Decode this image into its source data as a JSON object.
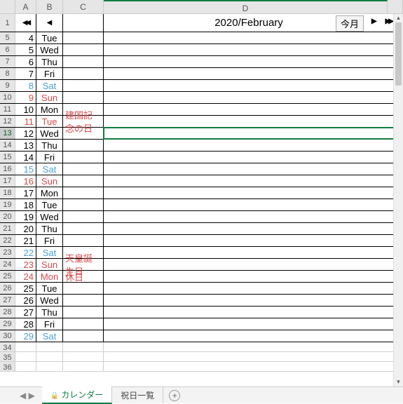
{
  "title": "2020/February",
  "today_btn": "今月",
  "nav": {
    "prev2": "◀◀",
    "prev": "◀",
    "next": "▶",
    "next2": "▶▶"
  },
  "columns": [
    "A",
    "B",
    "C",
    "D"
  ],
  "selected_row": 13,
  "rows": [
    {
      "n": 5,
      "day": "4",
      "dow": "Tue",
      "note": "",
      "cls": ""
    },
    {
      "n": 6,
      "day": "5",
      "dow": "Wed",
      "note": "",
      "cls": ""
    },
    {
      "n": 7,
      "day": "6",
      "dow": "Thu",
      "note": "",
      "cls": ""
    },
    {
      "n": 8,
      "day": "7",
      "dow": "Fri",
      "note": "",
      "cls": ""
    },
    {
      "n": 9,
      "day": "8",
      "dow": "Sat",
      "note": "",
      "cls": "sat"
    },
    {
      "n": 10,
      "day": "9",
      "dow": "Sun",
      "note": "",
      "cls": "sun"
    },
    {
      "n": 11,
      "day": "10",
      "dow": "Mon",
      "note": "",
      "cls": ""
    },
    {
      "n": 12,
      "day": "11",
      "dow": "Tue",
      "note": "建国記念の日",
      "cls": "hol"
    },
    {
      "n": 13,
      "day": "12",
      "dow": "Wed",
      "note": "",
      "cls": ""
    },
    {
      "n": 14,
      "day": "13",
      "dow": "Thu",
      "note": "",
      "cls": ""
    },
    {
      "n": 15,
      "day": "14",
      "dow": "Fri",
      "note": "",
      "cls": ""
    },
    {
      "n": 16,
      "day": "15",
      "dow": "Sat",
      "note": "",
      "cls": "sat"
    },
    {
      "n": 17,
      "day": "16",
      "dow": "Sun",
      "note": "",
      "cls": "sun"
    },
    {
      "n": 18,
      "day": "17",
      "dow": "Mon",
      "note": "",
      "cls": ""
    },
    {
      "n": 19,
      "day": "18",
      "dow": "Tue",
      "note": "",
      "cls": ""
    },
    {
      "n": 20,
      "day": "19",
      "dow": "Wed",
      "note": "",
      "cls": ""
    },
    {
      "n": 21,
      "day": "20",
      "dow": "Thu",
      "note": "",
      "cls": ""
    },
    {
      "n": 22,
      "day": "21",
      "dow": "Fri",
      "note": "",
      "cls": ""
    },
    {
      "n": 23,
      "day": "22",
      "dow": "Sat",
      "note": "",
      "cls": "sat"
    },
    {
      "n": 24,
      "day": "23",
      "dow": "Sun",
      "note": "天皇誕生日",
      "cls": "hol"
    },
    {
      "n": 25,
      "day": "24",
      "dow": "Mon",
      "note": "休日",
      "cls": "hol"
    },
    {
      "n": 26,
      "day": "25",
      "dow": "Tue",
      "note": "",
      "cls": ""
    },
    {
      "n": 27,
      "day": "26",
      "dow": "Wed",
      "note": "",
      "cls": ""
    },
    {
      "n": 28,
      "day": "27",
      "dow": "Thu",
      "note": "",
      "cls": ""
    },
    {
      "n": 29,
      "day": "28",
      "dow": "Fri",
      "note": "",
      "cls": ""
    },
    {
      "n": 30,
      "day": "29",
      "dow": "Sat",
      "note": "",
      "cls": "sat"
    }
  ],
  "tabs": {
    "active": "カレンダー",
    "other": "祝日一覧"
  }
}
